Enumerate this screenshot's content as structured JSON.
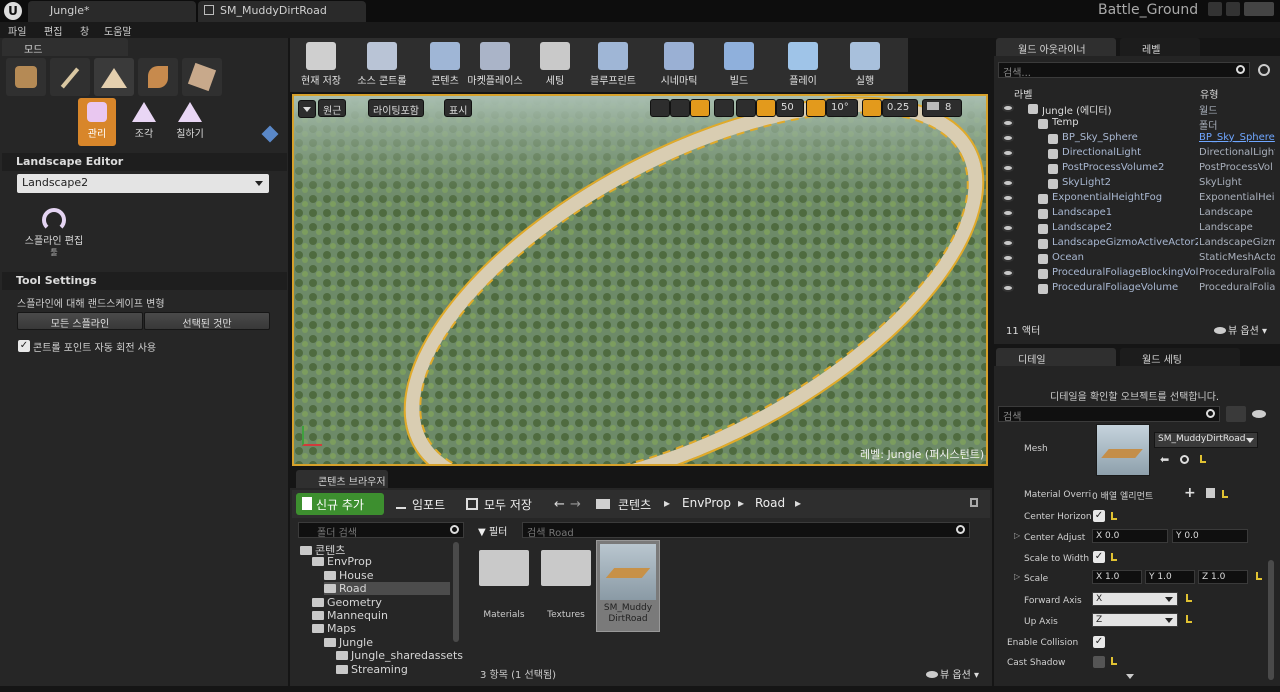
{
  "window": {
    "tabs": [
      "Jungle*",
      "SM_MuddyDirtRoad"
    ],
    "project": "Battle_Ground"
  },
  "menu": [
    "파일",
    "편집",
    "창",
    "도움말"
  ],
  "modes": {
    "title": "모드",
    "tools": [
      "관리",
      "조각",
      "칠하기"
    ],
    "editor_title": "Landscape Editor",
    "landscape_select": "Landscape2",
    "spline_tool": "스플라인 편집",
    "spline_tool_sub": "툴",
    "tool_settings_title": "Tool Settings",
    "deform_label": "스플라인에 대해 랜드스케이프 변형",
    "all_splines_btn": "모든 스플라인",
    "selected_only_btn": "선택된 것만",
    "auto_rotate_label": "콘트롤 포인트 자동 회전 사용"
  },
  "toolbar": [
    {
      "label": "현재 저장",
      "icon": "save-icon"
    },
    {
      "label": "소스 콘트롤",
      "icon": "source-control-icon"
    },
    {
      "label": "콘텐츠",
      "icon": "content-icon"
    },
    {
      "label": "마켓플레이스",
      "icon": "marketplace-icon"
    },
    {
      "label": "세팅",
      "icon": "settings-icon"
    },
    {
      "label": "블루프린트",
      "icon": "blueprint-icon"
    },
    {
      "label": "시네마틱",
      "icon": "cinematics-icon"
    },
    {
      "label": "빌드",
      "icon": "build-icon"
    },
    {
      "label": "플레이",
      "icon": "play-icon"
    },
    {
      "label": "실행",
      "icon": "launch-icon"
    }
  ],
  "viewport": {
    "perspective": "원근",
    "lit": "라이팅포함",
    "show": "표시",
    "grid_snap": "50",
    "rot_snap": "10°",
    "scale_snap": "0.25",
    "cam_speed": "8",
    "level_label": "레벨: Jungle (퍼시스턴트)"
  },
  "content_browser": {
    "tab": "콘텐츠 브라우저",
    "add_new": "신규 추가",
    "import": "임포트",
    "save_all": "모두 저장",
    "breadcrumb": [
      "콘텐츠",
      "EnvProp",
      "Road"
    ],
    "folder_search_placeholder": "폴더 검색",
    "filter": "필터",
    "asset_search_placeholder": "검색 Road",
    "tree": [
      {
        "label": "콘텐츠",
        "depth": 0
      },
      {
        "label": "EnvProp",
        "depth": 1
      },
      {
        "label": "House",
        "depth": 2
      },
      {
        "label": "Road",
        "depth": 2
      },
      {
        "label": "Geometry",
        "depth": 1
      },
      {
        "label": "Mannequin",
        "depth": 1
      },
      {
        "label": "Maps",
        "depth": 1
      },
      {
        "label": "Jungle",
        "depth": 2
      },
      {
        "label": "Jungle_sharedassets",
        "depth": 3
      },
      {
        "label": "Streaming",
        "depth": 3
      }
    ],
    "assets": [
      "Materials",
      "Textures",
      "SM_Muddy DirtRoad"
    ],
    "item_count": "3 항목 (1 선택됨)",
    "view_options": "뷰 옵션"
  },
  "outliner": {
    "tab": "월드 아웃라이너",
    "tab2": "레벨",
    "search_placeholder": "검색...",
    "col_label": "라벨",
    "col_type": "유형",
    "rows": [
      {
        "label": "Jungle (에디터)",
        "type": "월드"
      },
      {
        "label": "Temp",
        "type": "폴더"
      },
      {
        "label": "BP_Sky_Sphere",
        "type": "BP_Sky_Sphere"
      },
      {
        "label": "DirectionalLight",
        "type": "DirectionalLight"
      },
      {
        "label": "PostProcessVolume2",
        "type": "PostProcessVol"
      },
      {
        "label": "SkyLight2",
        "type": "SkyLight"
      },
      {
        "label": "ExponentialHeightFog",
        "type": "ExponentialHeig"
      },
      {
        "label": "Landscape1",
        "type": "Landscape"
      },
      {
        "label": "Landscape2",
        "type": "Landscape"
      },
      {
        "label": "LandscapeGizmoActiveActor2",
        "type": "LandscapeGizm"
      },
      {
        "label": "Ocean",
        "type": "StaticMeshActor"
      },
      {
        "label": "ProceduralFoliageBlockingVol",
        "type": "ProceduralFolia"
      },
      {
        "label": "ProceduralFoliageVolume",
        "type": "ProceduralFolia"
      }
    ],
    "actor_count": "11 액터",
    "view_options": "뷰 옵션"
  },
  "details": {
    "tab": "디테일",
    "tab2": "월드 세팅",
    "hint": "디테일을 확인할 오브젝트를 선택합니다.",
    "search_placeholder": "검색",
    "mesh_label": "Mesh",
    "mesh_value": "SM_MuddyDirtRoad",
    "material_override_label": "Material Overri",
    "material_override_value": "0 배열 엘리먼트",
    "center_horizontally": "Center Horizon",
    "center_adjust": "Center Adjust",
    "center_adjust_x": "X  0.0",
    "center_adjust_y": "Y  0.0",
    "scale_to_width": "Scale to Width",
    "scale": "Scale",
    "scale_x": "X  1.0",
    "scale_y": "Y  1.0",
    "scale_z": "Z  1.0",
    "forward_axis": "Forward Axis",
    "forward_axis_value": "X",
    "up_axis": "Up Axis",
    "up_axis_value": "Z",
    "enable_collision": "Enable Collision",
    "cast_shadow": "Cast Shadow"
  }
}
